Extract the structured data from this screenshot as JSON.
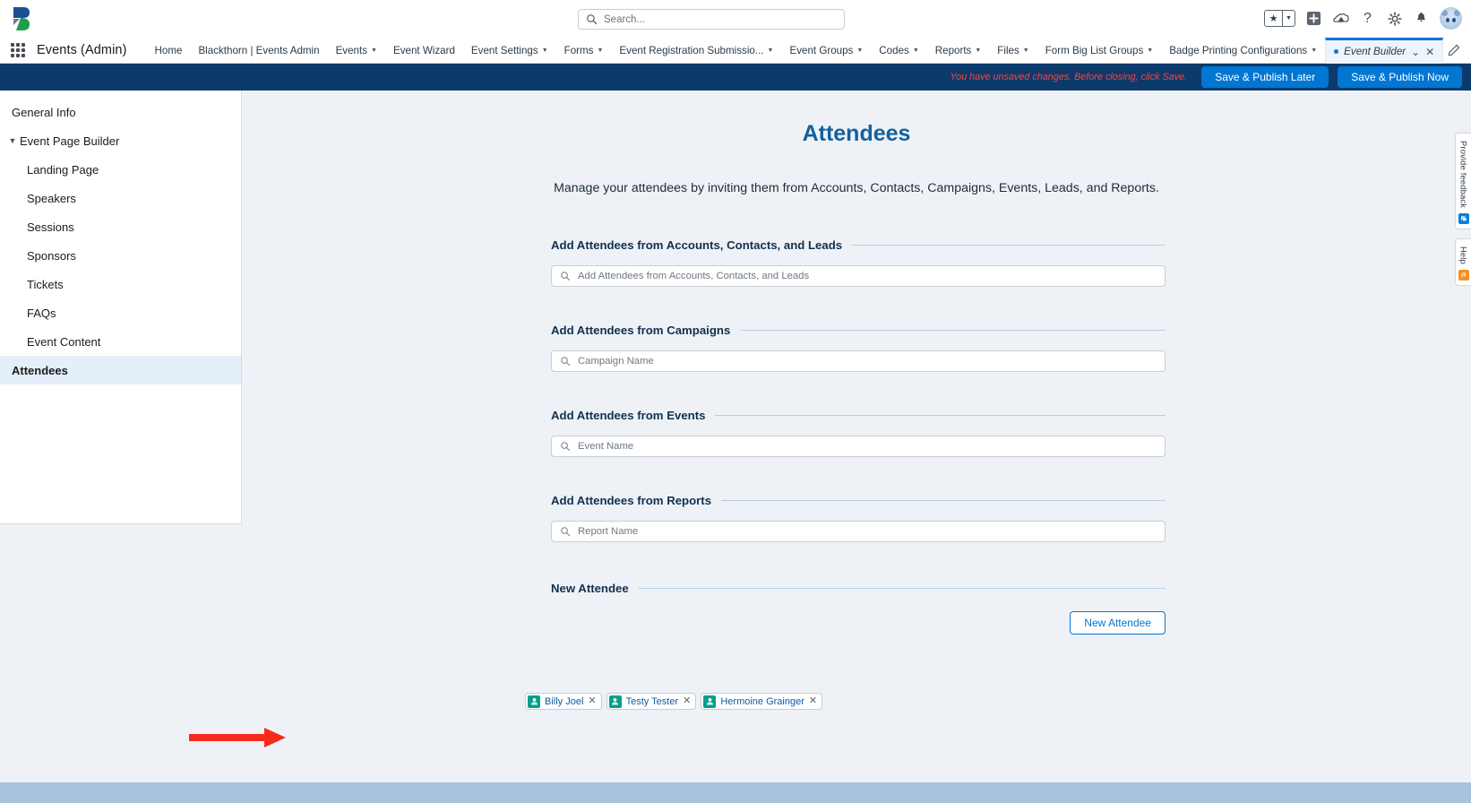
{
  "header": {
    "logo_icon": "blackthorn-b-logo",
    "search": {
      "placeholder": "Search...",
      "icon": "search-icon"
    },
    "icons": [
      {
        "name": "favorites-star-icon",
        "glyph": "★"
      },
      {
        "name": "favorites-dropdown-icon",
        "glyph": "▾"
      },
      {
        "name": "add-icon",
        "glyph": "+"
      },
      {
        "name": "app-launcher-cloud-icon",
        "glyph": "☁"
      },
      {
        "name": "help-question-icon",
        "glyph": "?"
      },
      {
        "name": "setup-gear-icon",
        "glyph": "⚙"
      },
      {
        "name": "notifications-bell-icon",
        "glyph": "🔔"
      }
    ],
    "avatar_name": "user-avatar"
  },
  "appnav": {
    "app_name": "Events (Admin)",
    "items": [
      {
        "label": "Home",
        "has_menu": false
      },
      {
        "label": "Blackthorn | Events Admin",
        "has_menu": false
      },
      {
        "label": "Events",
        "has_menu": true
      },
      {
        "label": "Event Wizard",
        "has_menu": false
      },
      {
        "label": "Event Settings",
        "has_menu": true
      },
      {
        "label": "Forms",
        "has_menu": true
      },
      {
        "label": "Event Registration Submissio...",
        "has_menu": true
      },
      {
        "label": "Event Groups",
        "has_menu": true
      },
      {
        "label": "Codes",
        "has_menu": true
      },
      {
        "label": "Reports",
        "has_menu": true
      },
      {
        "label": "Files",
        "has_menu": true
      },
      {
        "label": "Form Big List Groups",
        "has_menu": true
      },
      {
        "label": "Badge Printing Configurations",
        "has_menu": true
      }
    ],
    "active_tab": {
      "label": "Event Builder",
      "unsaved_marker": "•",
      "chevron": "⌄",
      "close": "✕"
    },
    "edit_icon": "pencil-icon"
  },
  "savebar": {
    "warning": "You have unsaved changes. Before closing, click Save.",
    "save_publish_later": "Save & Publish Later",
    "save_publish_now": "Save & Publish Now",
    "background": "#0b3a6b",
    "warning_color": "#fc4040",
    "button_color": "#0176d3"
  },
  "sidebar": {
    "items": [
      {
        "label": "General Info",
        "level": 0,
        "caret": false,
        "active": false
      },
      {
        "label": "Event Page Builder",
        "level": 0,
        "caret": true,
        "active": false
      },
      {
        "label": "Landing Page",
        "level": 1,
        "caret": false,
        "active": false
      },
      {
        "label": "Speakers",
        "level": 1,
        "caret": false,
        "active": false
      },
      {
        "label": "Sessions",
        "level": 1,
        "caret": false,
        "active": false
      },
      {
        "label": "Sponsors",
        "level": 1,
        "caret": false,
        "active": false
      },
      {
        "label": "Tickets",
        "level": 1,
        "caret": false,
        "active": false
      },
      {
        "label": "FAQs",
        "level": 1,
        "caret": false,
        "active": false
      },
      {
        "label": "Event Content",
        "level": 1,
        "caret": false,
        "active": false
      },
      {
        "label": "Attendees",
        "level": 0,
        "caret": false,
        "active": true
      }
    ]
  },
  "main": {
    "title": "Attendees",
    "subtitle": "Manage your attendees by inviting them from Accounts, Contacts, Campaigns, Events, Leads, and Reports.",
    "title_color": "#14609e",
    "sections": [
      {
        "heading": "Add Attendees from Accounts, Contacts, and Leads",
        "placeholder": "Add Attendees from Accounts, Contacts, and Leads",
        "has_input": true
      },
      {
        "heading": "Add Attendees from Campaigns",
        "placeholder": "Campaign Name",
        "has_input": true
      },
      {
        "heading": "Add Attendees from Events",
        "placeholder": "Event Name",
        "has_input": true
      },
      {
        "heading": "Add Attendees from Reports",
        "placeholder": "Report Name",
        "has_input": true
      },
      {
        "heading": "New Attendee",
        "placeholder": "",
        "has_input": false
      }
    ],
    "new_attendee_button": "New Attendee",
    "attendee_pills": [
      {
        "name": "Billy Joel",
        "icon": "person-icon",
        "remove": "✕"
      },
      {
        "name": "Testy Tester",
        "icon": "person-icon",
        "remove": "✕"
      },
      {
        "name": "Hermoine Grainger",
        "icon": "person-icon",
        "remove": "✕"
      }
    ],
    "pill_icon_color": "#04a08c",
    "pill_text_color": "#0b5cab",
    "annotation_arrow_color": "#f42b18"
  },
  "rail": [
    {
      "label": "Provide feedback",
      "badge_color": "#0b7fe0",
      "badge_icon": "chat-icon"
    },
    {
      "label": "Help",
      "badge_color": "#f59324",
      "badge_icon": "lifering-icon"
    }
  ]
}
